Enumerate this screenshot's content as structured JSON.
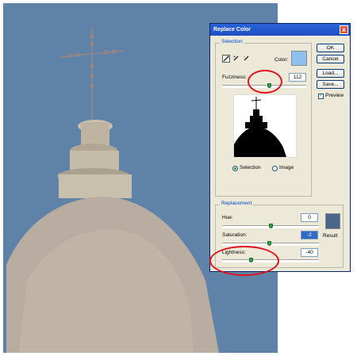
{
  "photo": {
    "sky_color": "#5e82a8",
    "stone_color": "#b8ada0"
  },
  "dialog": {
    "title": "Replace Color",
    "close_glyph": "x",
    "selection": {
      "label": "Selection",
      "color_label": "Color:",
      "color_value": "#8ec1ef",
      "fuzziness_label": "Fuzziness:",
      "fuzziness_value": "112",
      "fuzziness_slider": 0.56,
      "mode_selection": "Selection",
      "mode_image": "Image",
      "selected_mode": "Selection"
    },
    "buttons": {
      "ok": "OK",
      "cancel": "Cancel",
      "load": "Load...",
      "save": "Save..."
    },
    "preview": {
      "label": "Preview",
      "checked": true
    },
    "replacement": {
      "label": "Replacement",
      "hue_label": "Hue:",
      "hue_value": "0",
      "saturation_label": "Saturation:",
      "saturation_value": "-2",
      "lightness_label": "Lightness:",
      "lightness_value": "-40",
      "result_label": "Result",
      "result_color": "#4a6688"
    }
  }
}
